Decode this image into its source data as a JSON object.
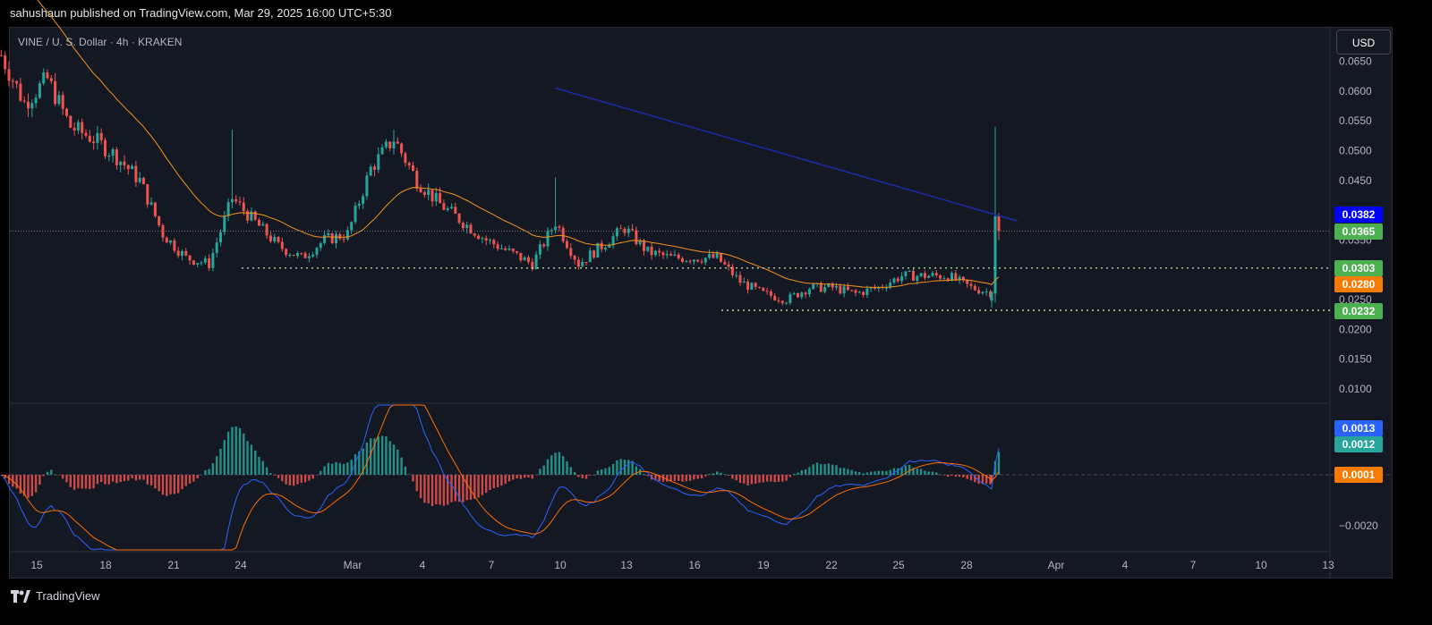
{
  "header": {
    "published": "sahushaun published on TradingView.com, Mar 29, 2025 16:00 UTC+5:30"
  },
  "symbol": {
    "label": "VINE / U. S. Dollar · 4h · KRAKEN"
  },
  "currency_button": "USD",
  "price_axis": {
    "ticks": [
      "0.0650",
      "0.0600",
      "0.0550",
      "0.0500",
      "0.0450",
      "0.0350",
      "0.0250",
      "0.0200",
      "0.0150",
      "0.0100"
    ]
  },
  "indicator_axis": {
    "ticks": [
      "−0.0020"
    ]
  },
  "time_axis": {
    "ticks": [
      "15",
      "18",
      "21",
      "24",
      "Mar",
      "4",
      "7",
      "10",
      "13",
      "16",
      "19",
      "22",
      "25",
      "28",
      "Apr",
      "4",
      "7",
      "10",
      "13"
    ]
  },
  "price_labels": [
    {
      "text": "0.0382",
      "color": "#0000ff"
    },
    {
      "text": "0.0365",
      "color": "#4caf50"
    },
    {
      "text": "0.0303",
      "color": "#4caf50"
    },
    {
      "text": "0.0280",
      "color": "#f57c00"
    },
    {
      "text": "0.0232",
      "color": "#4caf50"
    }
  ],
  "indicator_labels": [
    {
      "text": "0.0013",
      "color": "#2962ff"
    },
    {
      "text": "0.0012",
      "color": "#26a69a"
    },
    {
      "text": "0.0001",
      "color": "#f57c00"
    }
  ],
  "colors": {
    "up": "#26a69a",
    "down": "#ef5350",
    "ema": "#f7931a",
    "trendline": "#1f2aa8",
    "level": "#b7e8b3",
    "macd": "#2962ff",
    "signal": "#ff6d00"
  },
  "chart_data": {
    "type": "candlestick",
    "symbol": "VINE / U. S. Dollar",
    "interval": "4h",
    "exchange": "KRAKEN",
    "currency": "USD",
    "y_range": [
      0.007,
      0.068
    ],
    "anchors": [
      {
        "date": "Feb 13",
        "close": 0.066
      },
      {
        "date": "Feb 14",
        "close": 0.058
      },
      {
        "date": "Feb 15",
        "close": 0.062
      },
      {
        "date": "Feb 16",
        "close": 0.054
      },
      {
        "date": "Feb 17",
        "close": 0.052
      },
      {
        "date": "Feb 18",
        "close": 0.049
      },
      {
        "date": "Feb 19",
        "close": 0.045
      },
      {
        "date": "Feb 20",
        "close": 0.036
      },
      {
        "date": "Feb 21",
        "close": 0.032
      },
      {
        "date": "Feb 22",
        "close": 0.031
      },
      {
        "date": "Feb 23",
        "close": 0.042
      },
      {
        "date": "Feb 24",
        "close": 0.038
      },
      {
        "date": "Feb 25",
        "close": 0.034
      },
      {
        "date": "Feb 26",
        "close": 0.032
      },
      {
        "date": "Feb 27",
        "close": 0.035
      },
      {
        "date": "Feb 28",
        "close": 0.036
      },
      {
        "date": "Mar 1",
        "close": 0.047
      },
      {
        "date": "Mar 2",
        "close": 0.052
      },
      {
        "date": "Mar 3",
        "close": 0.045
      },
      {
        "date": "Mar 4",
        "close": 0.041
      },
      {
        "date": "Mar 5",
        "close": 0.038
      },
      {
        "date": "Mar 6",
        "close": 0.035
      },
      {
        "date": "Mar 7",
        "close": 0.033
      },
      {
        "date": "Mar 8",
        "close": 0.031
      },
      {
        "date": "Mar 9",
        "close": 0.038
      },
      {
        "date": "Mar 10",
        "close": 0.031
      },
      {
        "date": "Mar 11",
        "close": 0.034
      },
      {
        "date": "Mar 12",
        "close": 0.037
      },
      {
        "date": "Mar 13",
        "close": 0.033
      },
      {
        "date": "Mar 14",
        "close": 0.032
      },
      {
        "date": "Mar 15",
        "close": 0.032
      },
      {
        "date": "Mar 16",
        "close": 0.032
      },
      {
        "date": "Mar 17",
        "close": 0.028
      },
      {
        "date": "Mar 18",
        "close": 0.026
      },
      {
        "date": "Mar 19",
        "close": 0.025
      },
      {
        "date": "Mar 20",
        "close": 0.027
      },
      {
        "date": "Mar 21",
        "close": 0.027
      },
      {
        "date": "Mar 22",
        "close": 0.026
      },
      {
        "date": "Mar 23",
        "close": 0.027
      },
      {
        "date": "Mar 24",
        "close": 0.029
      },
      {
        "date": "Mar 25",
        "close": 0.029
      },
      {
        "date": "Mar 26",
        "close": 0.029
      },
      {
        "date": "Mar 27",
        "close": 0.027
      },
      {
        "date": "Mar 28",
        "close": 0.026
      },
      {
        "date": "Mar 29",
        "close": 0.0365
      }
    ],
    "last_candle": {
      "date": "Mar 29",
      "open": 0.026,
      "high": 0.054,
      "low": 0.0245,
      "close": 0.0365
    },
    "ema": {
      "value": 0.028
    },
    "trendline": {
      "start": {
        "date": "Mar 9",
        "price": 0.0605
      },
      "end": {
        "date": "Mar 29",
        "price": 0.0382
      }
    },
    "support_levels": [
      0.0303,
      0.0232
    ],
    "macd": {
      "macd": 0.0013,
      "signal": 0.0012,
      "histogram": 0.0001
    }
  }
}
